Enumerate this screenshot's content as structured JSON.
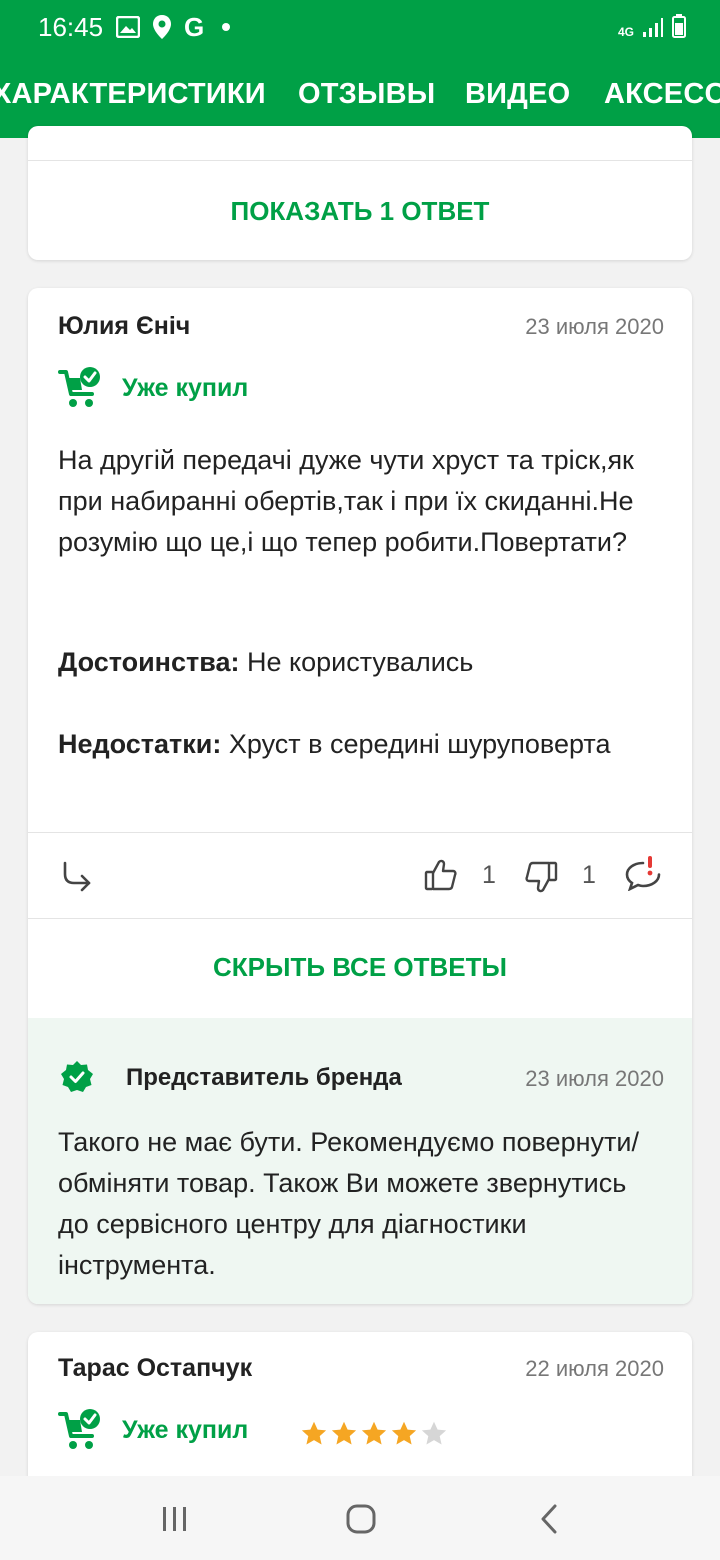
{
  "status_bar": {
    "time": "16:45",
    "network": "4G"
  },
  "tabs": [
    {
      "label": "ХАРАКТЕРИСТИКИ"
    },
    {
      "label": "ОТЗЫВЫ"
    },
    {
      "label": "ВИДЕО"
    },
    {
      "label": "АКСЕССУ"
    }
  ],
  "prev_card": {
    "show_replies_label": "ПОКАЗАТЬ 1 ОТВЕТ"
  },
  "review": {
    "author": "Юлия Єніч",
    "date": "23 июля 2020",
    "bought_label": "Уже купил",
    "text": "На другій передачі дуже чути хруст та тріск,як при набиранні обертів,так і при їх скиданні.Не розумію що це,і що тепер робити.Повертати?",
    "pros_label": "Достоинства:",
    "pros_value": "Не користувались",
    "cons_label": "Недостатки:",
    "cons_value": "Хруст в середині шуруповерта",
    "likes": "1",
    "dislikes": "1",
    "hide_replies_label": "СКРЫТЬ ВСЕ ОТВЕТЫ",
    "reply": {
      "author": "Представитель бренда",
      "date": "23 июля 2020",
      "text": "Такого не має бути. Рекомендуємо повернути/обміняти товар. Також Ви можете звернутись до сервісного центру для діагностики інструмента."
    }
  },
  "next_review": {
    "author": "Тарас Остапчук",
    "date": "22 июля 2020",
    "bought_label": "Уже купил",
    "rating": 4,
    "rating_max": 5
  },
  "colors": {
    "brand_green": "#00a046",
    "star": "#f5a623",
    "alert_red": "#e53935"
  }
}
